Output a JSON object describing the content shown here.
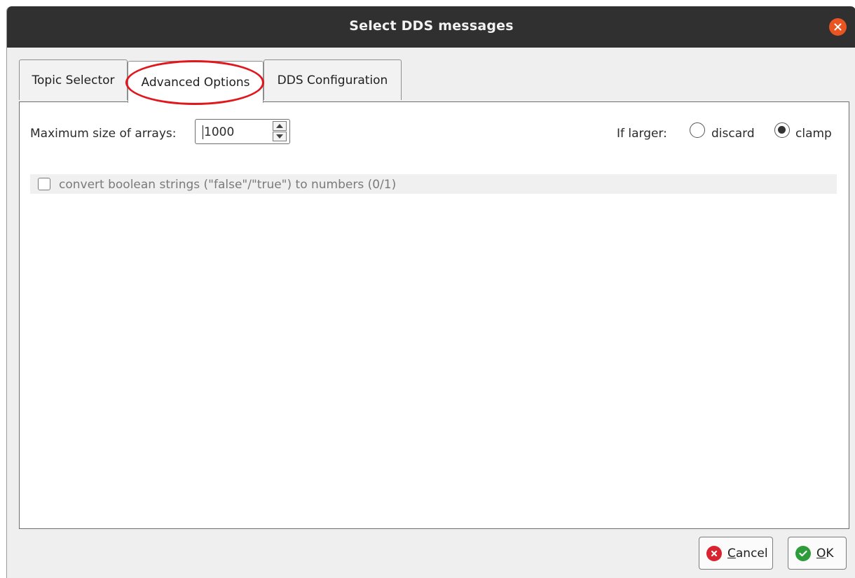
{
  "window": {
    "title": "Select DDS messages"
  },
  "tabs": [
    {
      "label": "Topic Selector",
      "active": false
    },
    {
      "label": "Advanced Options",
      "active": true
    },
    {
      "label": "DDS Configuration",
      "active": false
    }
  ],
  "advanced": {
    "max_size_label": "Maximum size of arrays:",
    "max_size_value": "1000",
    "if_larger_label": "If larger:",
    "options": [
      {
        "label": "discard",
        "checked": false
      },
      {
        "label": "clamp",
        "checked": true
      }
    ],
    "bool_convert_label": "convert boolean strings (\"false\"/\"true\") to numbers (0/1)",
    "bool_convert_checked": false
  },
  "buttons": {
    "cancel": {
      "mnemonic": "C",
      "rest": "ancel",
      "icon": "cancel-icon"
    },
    "ok": {
      "mnemonic": "O",
      "rest": "K",
      "icon": "check-icon"
    }
  },
  "colors": {
    "titlebar": "#303030",
    "close": "#e95420",
    "highlight": "#e0171d",
    "cancel_icon": "#d92330",
    "ok_icon": "#2e9c3a"
  }
}
